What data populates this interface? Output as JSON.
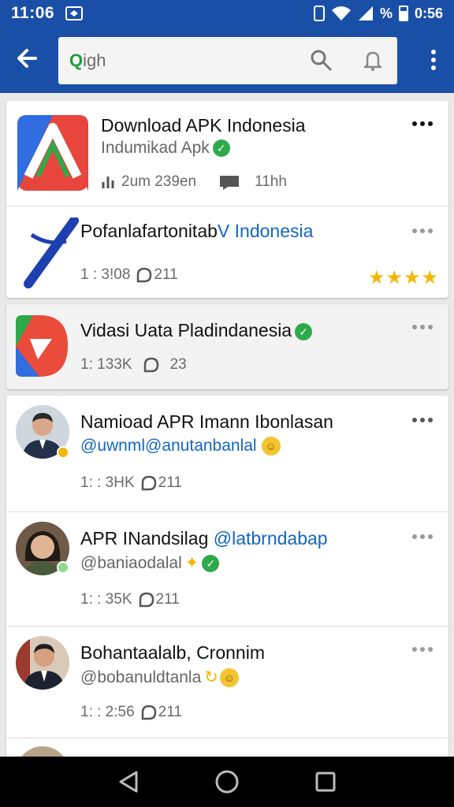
{
  "status_bar": {
    "time": "11:06",
    "right_text": "0:56",
    "percent_symbol": "%"
  },
  "search": {
    "query_prefix": "Q",
    "query": "igh"
  },
  "colors": {
    "app_bar": "#1a4fa8",
    "handle_blue": "#1565c0",
    "verified_green": "#2eaa4a",
    "star_gold": "#f2b705"
  },
  "results": [
    {
      "title": "Download APK Indonesia",
      "subtitle": "Indumikad Apk",
      "meta_a": "2um 239en",
      "meta_b": "11hh",
      "icon": "apk-store-app-icon"
    },
    {
      "title": "Pofanlafartonitab",
      "title_accent": "V Indonesia",
      "meta_a": "1 : 3!08",
      "meta_b": "211",
      "rating_stars": 4,
      "icon": "x-cross-app-icon"
    },
    {
      "title": "Vidasi Uata Pladindanesia",
      "meta_a": "1: 133K",
      "meta_b": "23",
      "icon": "red-green-app-icon"
    },
    {
      "title": "Namioad APR Imann Ibonlasan",
      "handle": "@uwnml@anutanbanlal",
      "meta_a": "1: : 3HK",
      "meta_b": "211",
      "icon": "man-avatar"
    },
    {
      "title": "APR INandsilag",
      "title_accent": "@latbrndabap",
      "handle": "@baniaodalal",
      "meta_a": "1: : 35K",
      "meta_b": "211",
      "icon": "woman-avatar"
    },
    {
      "title": "Bohantaalalb, Cronnim",
      "handle": "@bobanuldtanla",
      "meta_a": "1: : 2:56",
      "meta_b": "211",
      "icon": "man-suit-avatar"
    }
  ]
}
